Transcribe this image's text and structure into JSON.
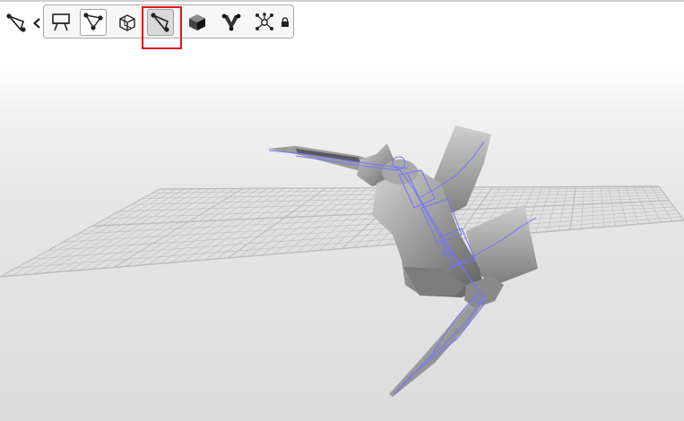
{
  "colors": {
    "wireframe": "#7474ff",
    "mesh_light": "#bdbdbd",
    "mesh_dark": "#6c6c6c",
    "grid": "#bcbcbc",
    "highlight": "#e0141e"
  },
  "left_indicator": {
    "icon": "bone-select-icon",
    "chevron": "chevron-left-icon"
  },
  "toolbar": {
    "buttons": [
      {
        "name": "viewport-easel-icon",
        "state": "normal"
      },
      {
        "name": "vertex-select-icon",
        "state": "selected"
      },
      {
        "name": "wireframe-cube-icon",
        "state": "normal"
      },
      {
        "name": "bone-select-icon",
        "state": "active"
      },
      {
        "name": "solid-cube-icon",
        "state": "normal"
      },
      {
        "name": "skin-weight-icon",
        "state": "normal"
      },
      {
        "name": "joint-network-icon",
        "state": "normal"
      },
      {
        "name": "lock-icon",
        "state": "normal"
      }
    ]
  }
}
